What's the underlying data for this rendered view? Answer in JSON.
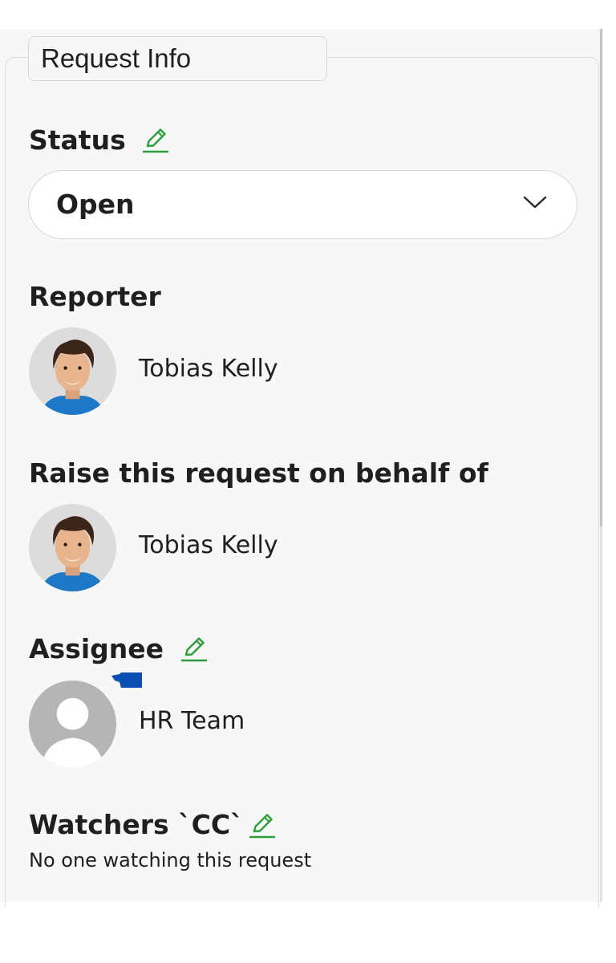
{
  "panel": {
    "title": "Request Info"
  },
  "status": {
    "label": "Status",
    "value": "Open"
  },
  "reporter": {
    "label": "Reporter",
    "name": "Tobias Kelly"
  },
  "on_behalf": {
    "label": "Raise this request on behalf of",
    "name": "Tobias Kelly"
  },
  "assignee": {
    "label": "Assignee",
    "name": "HR Team"
  },
  "watchers": {
    "label": "Watchers `CC`",
    "empty_text": "No one watching this request"
  },
  "icons": {
    "edit": "pencil-icon",
    "dropdown": "chevron-down-icon",
    "avatar_placeholder": "person-placeholder-icon"
  },
  "colors": {
    "edit_icon": "#2e9e3a",
    "panel_bg": "#f7f7f7",
    "text": "#1f1f1f",
    "marker": "#0b4fb5"
  }
}
